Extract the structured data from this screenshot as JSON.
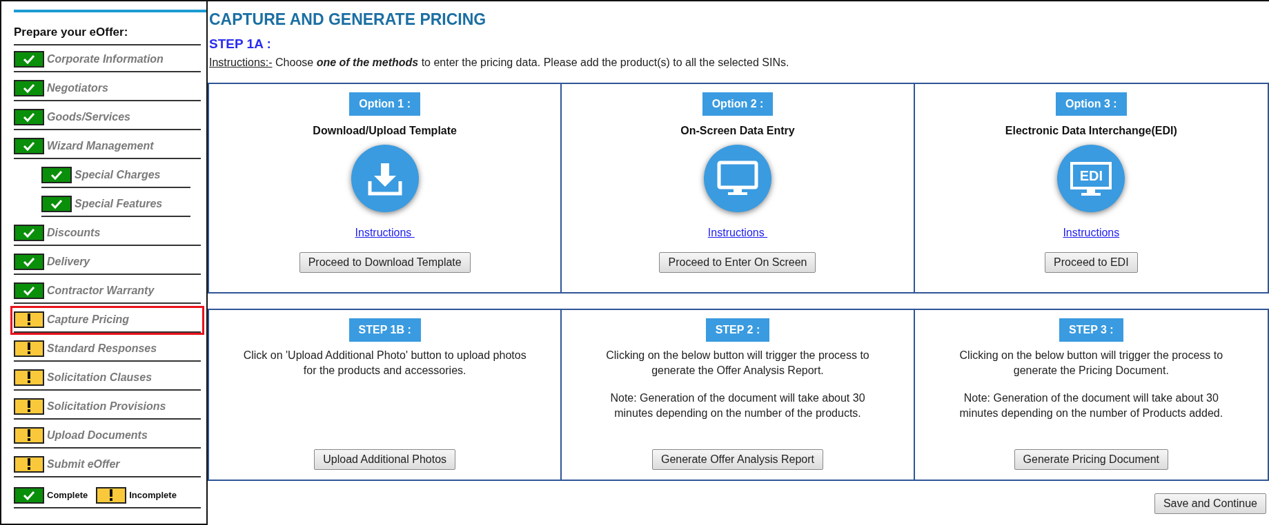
{
  "sidebar": {
    "title": "Prepare your eOffer:",
    "items": [
      {
        "label": "Corporate Information",
        "complete": true,
        "selected": false
      },
      {
        "label": "Negotiators",
        "complete": true,
        "selected": false
      },
      {
        "label": "Goods/Services",
        "complete": true,
        "selected": false
      },
      {
        "label": "Wizard Management",
        "complete": true,
        "selected": false,
        "children": [
          {
            "label": "Special Charges",
            "complete": true,
            "selected": false
          },
          {
            "label": "Special Features",
            "complete": true,
            "selected": false
          }
        ]
      },
      {
        "label": "Discounts",
        "complete": true,
        "selected": false
      },
      {
        "label": "Delivery",
        "complete": true,
        "selected": false
      },
      {
        "label": "Contractor Warranty",
        "complete": true,
        "selected": false
      },
      {
        "label": "Capture Pricing",
        "complete": false,
        "selected": true
      },
      {
        "label": "Standard Responses",
        "complete": false,
        "selected": false
      },
      {
        "label": "Solicitation Clauses",
        "complete": false,
        "selected": false
      },
      {
        "label": "Solicitation Provisions",
        "complete": false,
        "selected": false
      },
      {
        "label": "Upload Documents",
        "complete": false,
        "selected": false
      },
      {
        "label": "Submit eOffer",
        "complete": false,
        "selected": false
      }
    ],
    "legend": [
      {
        "complete": true,
        "label": "Complete"
      },
      {
        "complete": false,
        "label": "Incomplete"
      }
    ]
  },
  "main": {
    "title": "CAPTURE AND GENERATE PRICING",
    "step": "STEP 1A :",
    "instructions": {
      "lead": "Instructions:-",
      "text": " Choose **one of the methods** to enter the pricing data. Please add the product(s) to all the selected SINs."
    },
    "options": [
      {
        "badge": "Option 1 :",
        "title": "Download/Upload Template",
        "icon": {
          "kind": "download"
        },
        "link": "Instructions ",
        "button": "Proceed to Download Template"
      },
      {
        "badge": "Option 2 :",
        "title": "On-Screen Data Entry",
        "icon": {
          "kind": "monitor"
        },
        "link": "Instructions ",
        "button": "Proceed to Enter On Screen"
      },
      {
        "badge": "Option 3 :",
        "title": "Electronic Data Interchange(EDI)",
        "icon": {
          "kind": "edi",
          "text": "EDI"
        },
        "link": "Instructions",
        "button": "Proceed to EDI"
      }
    ],
    "steps": [
      {
        "badge": "STEP 1B :",
        "paragraphs": [
          "Click on 'Upload Additional Photo' button to upload photos for the products and accessories."
        ],
        "button": "Upload Additional Photos"
      },
      {
        "badge": "STEP 2 :",
        "paragraphs": [
          "Clicking on the below button will trigger the process to generate the Offer Analysis Report.",
          "Note: Generation of the document will take about 30 minutes depending on the number of the products."
        ],
        "button": "Generate Offer Analysis Report"
      },
      {
        "badge": "STEP 3 :",
        "paragraphs": [
          "Clicking on the below button will trigger the process to generate the Pricing Document.",
          "Note: Generation of the document will take about 30 minutes depending on the number of Products added."
        ],
        "button": "Generate Pricing Document"
      }
    ],
    "save_button": "Save and Continue"
  }
}
